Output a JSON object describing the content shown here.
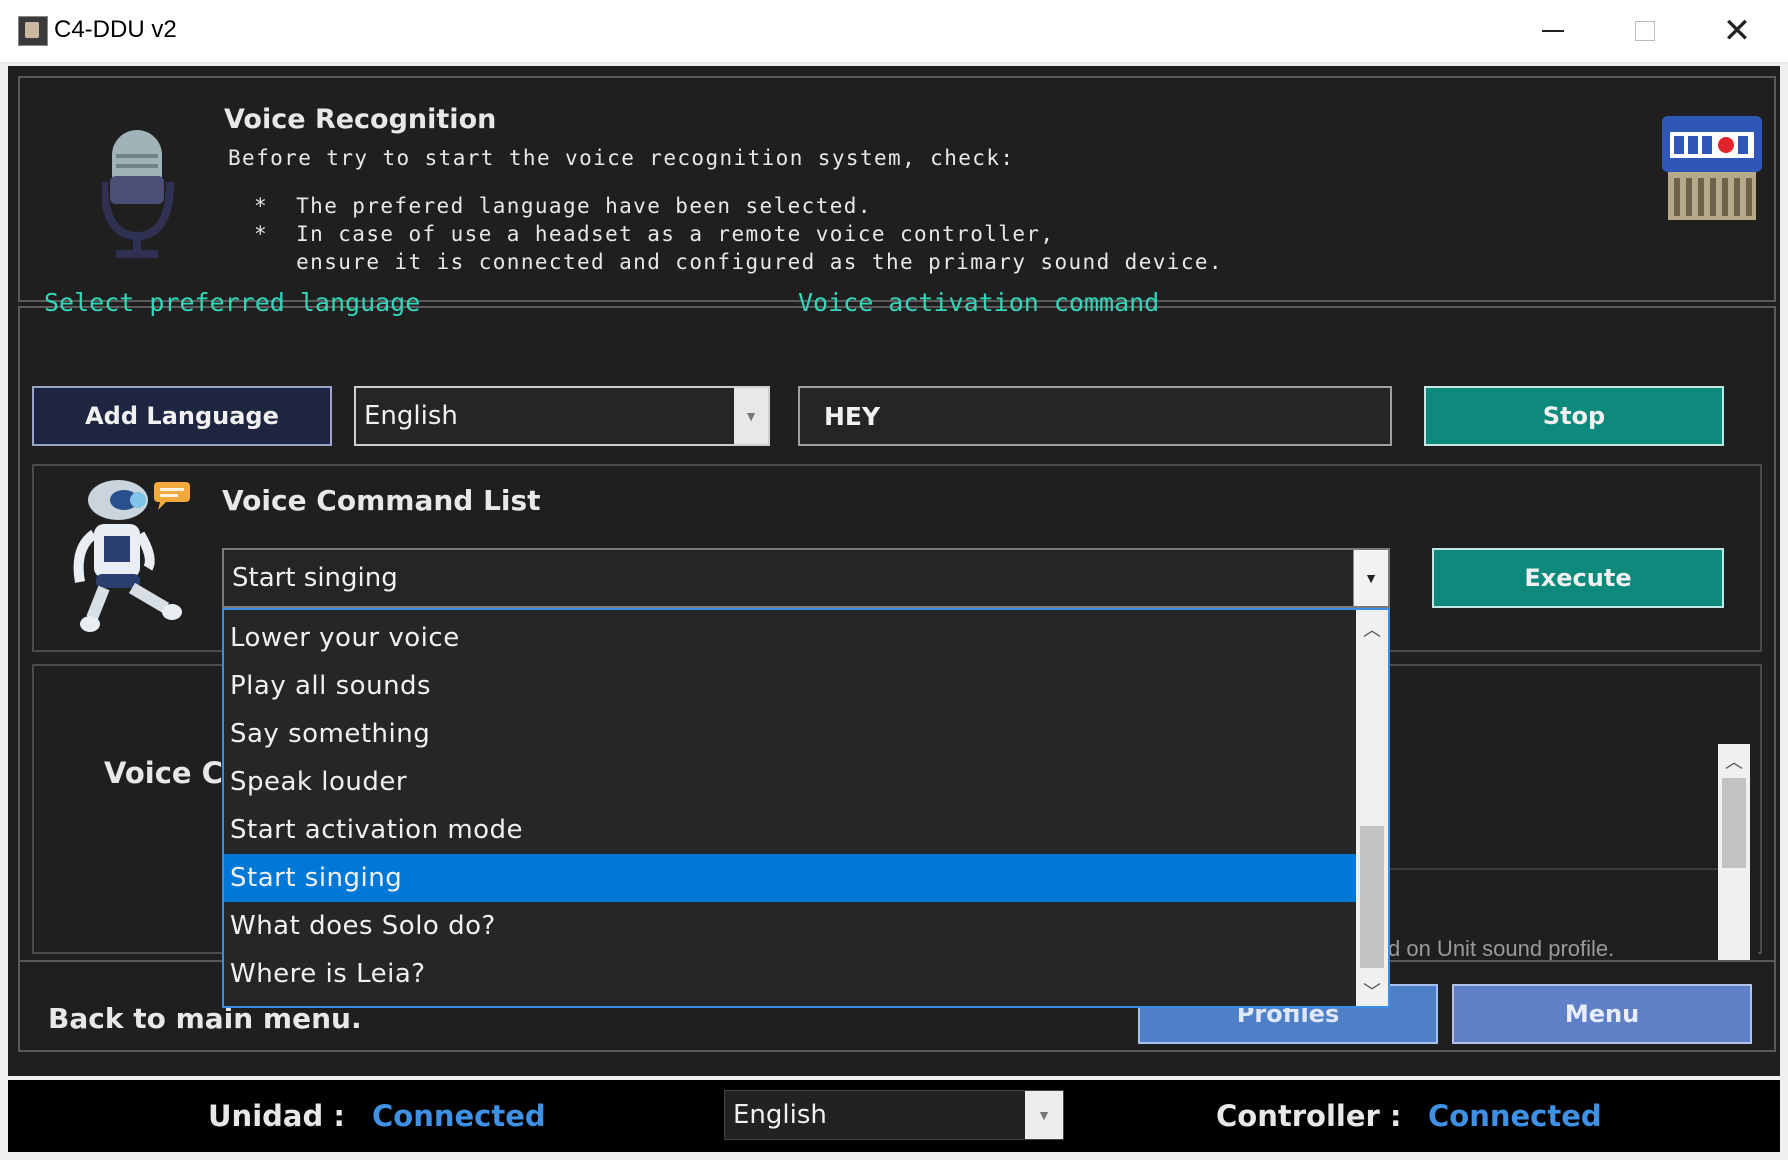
{
  "window": {
    "title": "C4-DDU v2",
    "controls": [
      "minimize",
      "maximize",
      "close"
    ],
    "close_glyph": "✕"
  },
  "intro": {
    "heading": "Voice Recognition",
    "line1": "Before try to start the voice recognition system, check:",
    "bullet1": "*  The prefered language have been selected.",
    "bullet2": "*  In case of use a headset as a remote voice controller,",
    "bullet2b": "   ensure it is connected and configured as the primary sound device.",
    "icons": [
      "microphone-icon",
      "sd-card-icon"
    ]
  },
  "language": {
    "label": "Select preferred language",
    "add_button": "Add Language",
    "selected": "English"
  },
  "activation": {
    "label": "Voice activation command",
    "value": "HEY",
    "stop_button": "Stop"
  },
  "commands": {
    "heading": "Voice Command List",
    "selected": "Start singing",
    "execute_button": "Execute",
    "options": [
      "Lower your voice",
      "Play all sounds",
      "Say something",
      "Speak louder",
      "Start activation mode",
      "Start singing",
      "What does Solo do?",
      "Where is Leia?"
    ],
    "selected_index": 5
  },
  "response": {
    "label_partial": "Voice Co",
    "text_partial": "d on Unit sound profile."
  },
  "bottom": {
    "back_text": "Back to main menu.",
    "profiles_button": "Profiles",
    "menu_button": "Menu"
  },
  "status": {
    "unit_label": "Unidad :",
    "unit_value": "Connected",
    "language": "English",
    "controller_label": "Controller :",
    "controller_value": "Connected"
  },
  "colors": {
    "accent_teal": "#0d8a7c",
    "label_cyan": "#33d6b8",
    "selection_blue": "#0078d7",
    "status_blue": "#3e91e5"
  }
}
